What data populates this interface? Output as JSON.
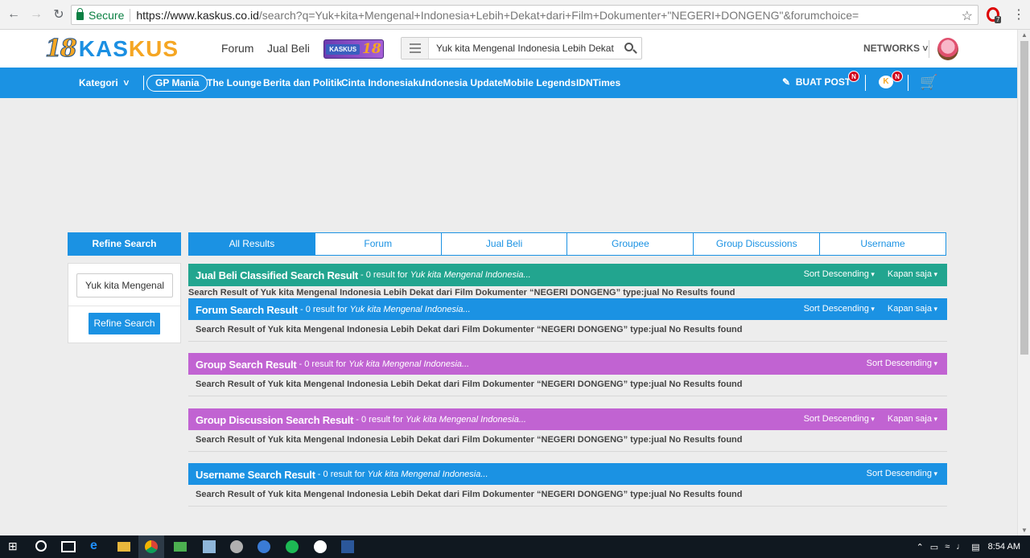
{
  "browser": {
    "secure_label": "Secure",
    "url_host": "https://www.kaskus.co.id",
    "url_rest": "/search?q=Yuk+kita+Mengenal+Indonesia+Lebih+Dekat+dari+Film+Dokumenter+\"NEGERI+DONGENG\"&forumchoice=",
    "ext_badge": "7"
  },
  "header": {
    "logo_num": "18",
    "logo_word_a": "KAS",
    "logo_word_b": "KUS",
    "nav": [
      "Forum",
      "Jual Beli"
    ],
    "badge_label": "KASKUS",
    "badge_num": "18",
    "search_value": "Yuk kita Mengenal Indonesia Lebih Dekat da",
    "networks": "NETWORKS"
  },
  "catbar": {
    "kategori": "Kategori",
    "pill": "GP Mania",
    "links": [
      "The Lounge",
      "Berita dan Politik",
      "Cinta Indonesiaku",
      "Indonesia Update",
      "Mobile Legends",
      "IDNTimes"
    ],
    "buat_post": "BUAT POST",
    "badge": "N"
  },
  "refine": {
    "heading": "Refine Search",
    "input_value": "Yuk kita Mengenal",
    "button": "Refine Search"
  },
  "tabs": [
    "All Results",
    "Forum",
    "Jual Beli",
    "Groupee",
    "Group Discussions",
    "Username"
  ],
  "results": {
    "query": "Yuk kita Mengenal Indonesia...",
    "count": "- 0 result for",
    "message": "Search Result of Yuk kita Mengenal Indonesia Lebih Dekat dari Film Dokumenter “NEGERI DONGENG” type:jual No Results found",
    "sort": "Sort Descending",
    "when": "Kapan saja",
    "sections": [
      {
        "title": "Jual Beli Classified Search Result"
      },
      {
        "title": "Forum Search Result"
      },
      {
        "title": "Group Search Result"
      },
      {
        "title": "Group Discussion Search Result"
      },
      {
        "title": "Username Search Result"
      }
    ]
  },
  "taskbar": {
    "clock": "8:54 AM"
  }
}
